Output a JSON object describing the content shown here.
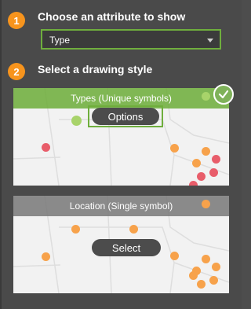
{
  "steps": [
    {
      "number": "1",
      "title": "Choose an attribute to show"
    },
    {
      "number": "2",
      "title": "Select a drawing style"
    }
  ],
  "attribute_select": {
    "value": "Type"
  },
  "styles": [
    {
      "title": "Types (Unique symbols)",
      "button_label": "Options",
      "selected": true
    },
    {
      "title": "Location (Single symbol)",
      "button_label": "Select",
      "selected": false
    }
  ],
  "colors": {
    "accent_orange": "#f7941d",
    "selected_green": "#6fae3d",
    "panel_bg": "#4a4a4a"
  },
  "icons": {
    "selected_check": "check-icon",
    "dropdown": "chevron-down-icon"
  }
}
